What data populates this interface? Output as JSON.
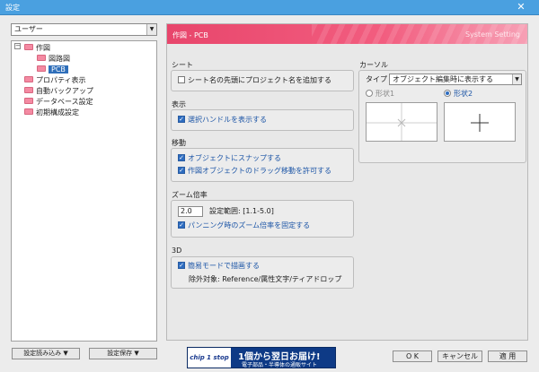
{
  "window": {
    "title": "設定",
    "close_glyph": "✕"
  },
  "category_combo": {
    "value": "ユーザー",
    "arrow": "▼"
  },
  "tree": {
    "expander": "−",
    "items": [
      {
        "label": "作図"
      },
      {
        "label": "図路図"
      },
      {
        "label": "PCB"
      },
      {
        "label": "プロパティ表示"
      },
      {
        "label": "自動バックアップ"
      },
      {
        "label": "データベース設定"
      },
      {
        "label": "初期構成設定"
      }
    ]
  },
  "left_buttons": {
    "load": "設定読み込み ▼",
    "save": "設定保存 ▼"
  },
  "panel": {
    "title": "作図 - PCB",
    "subtitle": "System Setting",
    "sheet": {
      "label": "シート",
      "option": "シート名の先頭にプロジェクト名を追加する"
    },
    "display": {
      "label": "表示",
      "option": "選択ハンドルを表示する"
    },
    "move": {
      "label": "移動",
      "option1": "オブジェクトにスナップする",
      "option2": "作図オブジェクトのドラッグ移動を許可する"
    },
    "zoom": {
      "label": "ズーム倍率",
      "value": "2.0",
      "range": "設定範囲: [1.1-5.0]",
      "option": "パンニング時のズーム倍率を固定する"
    },
    "three_d": {
      "label": "3D",
      "option": "簡易モードで描画する",
      "exclude": "除外対象: Reference/属性文字/ティアドロップ"
    },
    "cursor": {
      "label": "カーソル",
      "type_label": "タイプ",
      "type_value": "オブジェクト編集時に表示する",
      "arrow": "▼",
      "shape1": "形状1",
      "shape2": "形状2"
    }
  },
  "banner": {
    "logo": "chip 1 stop",
    "line1": "1個から翌日お届け!",
    "line2": "電子部品・半導体の通販サイト"
  },
  "dialog_buttons": {
    "ok": "O K",
    "cancel": "キャンセル",
    "apply": "適 用"
  },
  "colors": {
    "titlebar": "#4aa0e0",
    "header_pink": "#e8466c",
    "selection": "#2f6fba",
    "checkbox": "#2d6cc0",
    "banner": "#0e3a86"
  }
}
